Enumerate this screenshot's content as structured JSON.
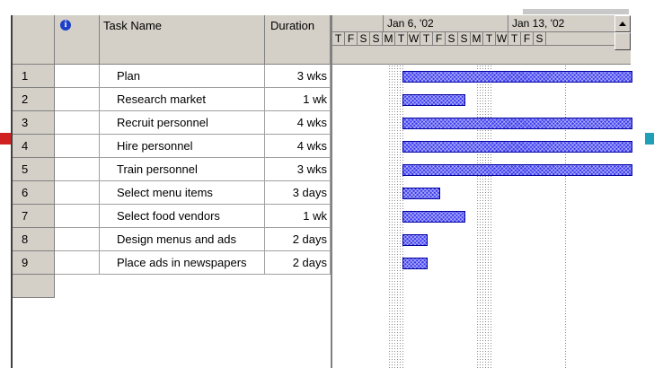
{
  "columns": {
    "info_icon": "info-icon",
    "task_name": "Task Name",
    "duration": "Duration"
  },
  "timescale": {
    "weeks": [
      {
        "label": "Jan 6, '02"
      },
      {
        "label": "Jan 13, '02"
      }
    ],
    "days": [
      "T",
      "F",
      "S",
      "S",
      "M",
      "T",
      "W",
      "T",
      "F",
      "S",
      "S",
      "M",
      "T",
      "W",
      "T",
      "F",
      "S"
    ]
  },
  "tasks": [
    {
      "id": "1",
      "name": "Plan",
      "duration": "3 wks"
    },
    {
      "id": "2",
      "name": "Research market",
      "duration": "1 wk"
    },
    {
      "id": "3",
      "name": "Recruit personnel",
      "duration": "4 wks"
    },
    {
      "id": "4",
      "name": "Hire personnel",
      "duration": "4 wks"
    },
    {
      "id": "5",
      "name": "Train personnel",
      "duration": "3 wks"
    },
    {
      "id": "6",
      "name": "Select menu items",
      "duration": "3 days"
    },
    {
      "id": "7",
      "name": "Select food vendors",
      "duration": "1 wk"
    },
    {
      "id": "8",
      "name": "Design menus and ads",
      "duration": "2 days"
    },
    {
      "id": "9",
      "name": "Place ads in newspapers",
      "duration": "2 days"
    }
  ],
  "colors": {
    "bar": "#3c3cf0",
    "header_bg": "#d4d0c8",
    "accent_left": "#d02020",
    "accent_right": "#20a0b8"
  }
}
